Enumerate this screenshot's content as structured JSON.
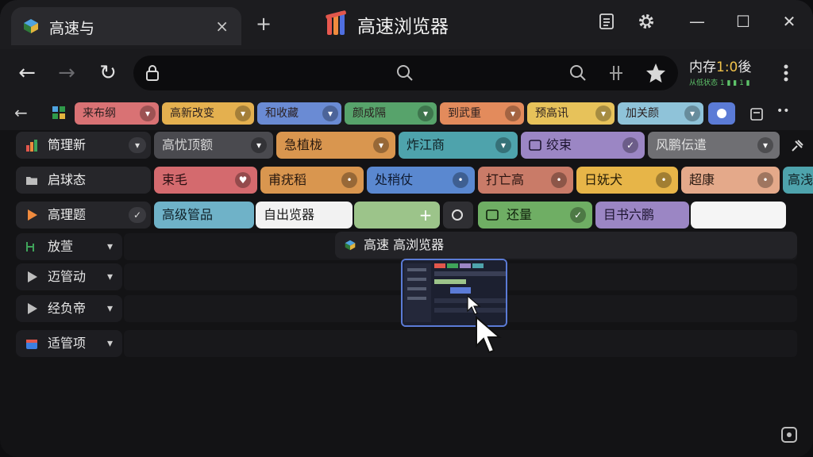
{
  "tab": {
    "title": "高速与",
    "close": "×",
    "new_tab": "+"
  },
  "brand": {
    "name": "高速浏览器"
  },
  "window_controls": {
    "menu_icon": "list-icon",
    "settings_icon": "gear-icon",
    "minimize": "—",
    "maximize": "☐",
    "close": "✕"
  },
  "toolbar": {
    "back": "←",
    "forward": "→",
    "reload": "↻",
    "memory_label": "内存",
    "memory_value": "1:0",
    "memory_suffix": "後",
    "memory_sub": "从低状态 1 ▮ ▮ 1 ▮"
  },
  "bookmarks": {
    "back": "←",
    "items": [
      {
        "label": "来布纲",
        "color": "#d97274"
      },
      {
        "label": "高新改变",
        "color": "#e4b04f"
      },
      {
        "label": "和收藏",
        "color": "#6a8bd4"
      },
      {
        "label": "颜成隔",
        "color": "#57a36b"
      },
      {
        "label": "到武重",
        "color": "#e38b5c"
      },
      {
        "label": "预高讯",
        "color": "#e7c25a"
      },
      {
        "label": "加关颜",
        "color": "#8fc3d9"
      }
    ],
    "more": "••"
  },
  "groups": [
    {
      "label": "筒理新",
      "chips": [
        {
          "label": "高忧顶额",
          "color": "#4a4a4f",
          "text": "#d8d8d8"
        },
        {
          "label": "急植栊",
          "color": "#d9964f",
          "text": "#2a1a10"
        },
        {
          "label": "炸江商",
          "color": "#4ea3ac",
          "text": "#102024"
        },
        {
          "label": "绞束",
          "color": "#9b86c4",
          "text": "#1d1530"
        },
        {
          "label": "风鹏伝遣",
          "color": "#6f6f73",
          "text": "#e0e0e0"
        }
      ]
    },
    {
      "label": "启球态",
      "chips": [
        {
          "label": "束毛",
          "color": "#d46a6e",
          "text": "#2a0f12"
        },
        {
          "label": "甫疣稻",
          "color": "#d9964f",
          "text": "#2a1a10"
        },
        {
          "label": "处稍仗",
          "color": "#5a88d0",
          "text": "#0f1a30"
        },
        {
          "label": "打亡高",
          "color": "#c97b68",
          "text": "#2a1410"
        },
        {
          "label": "日妩犬",
          "color": "#e7b548",
          "text": "#2a2008"
        },
        {
          "label": "超康",
          "color": "#e4a98a",
          "text": "#2a1a12"
        },
        {
          "label": "高浅",
          "color": "#4ea3ac",
          "text": "#102024"
        }
      ]
    },
    {
      "label": "高理题",
      "chips": [
        {
          "label": "高级管品",
          "color": "#6fb2c8",
          "text": "#0f1f26"
        },
        {
          "label": "自出览器",
          "color": "#f2f2f2",
          "text": "#1a1a1a"
        },
        {
          "label": "",
          "color": "#9cc48a",
          "text": "#1a2a12"
        },
        {
          "label": "",
          "color": "#2f2f33",
          "text": "#ddd"
        },
        {
          "label": "还量",
          "color": "#6fae64",
          "text": "#10200c"
        },
        {
          "label": "目书六鹏",
          "color": "#9b86c4",
          "text": "#1d1530"
        },
        {
          "label": "",
          "color": "#f5f5f5",
          "text": "#1a1a1a"
        }
      ]
    }
  ],
  "tree": [
    {
      "label": "放萱",
      "icon": "branch-icon",
      "chev": "▾"
    },
    {
      "label": "迈管动",
      "icon": "play-icon",
      "chev": "▾"
    },
    {
      "label": "经负帝",
      "icon": "play-icon",
      "chev": "▾"
    },
    {
      "label": "适管项",
      "icon": "calendar-icon",
      "chev": "▾"
    }
  ],
  "popup": {
    "title": "高速 高浏览器"
  },
  "colors": {
    "accent": "#5b7bd6",
    "memory_accent": "#f0c24b",
    "status_green": "#5ec46a"
  }
}
